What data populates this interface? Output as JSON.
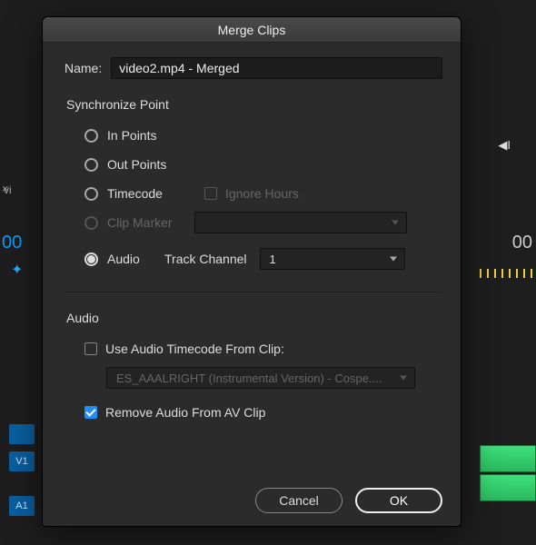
{
  "dialog": {
    "title": "Merge Clips",
    "name_label": "Name:",
    "name_value": "video2.mp4 - Merged",
    "sync": {
      "section_label": "Synchronize Point",
      "options": {
        "in_points": "In Points",
        "out_points": "Out Points",
        "timecode": "Timecode",
        "clip_marker": "Clip Marker",
        "audio": "Audio"
      },
      "selected": "audio",
      "ignore_hours_label": "Ignore Hours",
      "track_channel_label": "Track Channel",
      "track_channel_value": "1"
    },
    "audio": {
      "section_label": "Audio",
      "use_timecode_label": "Use Audio Timecode From Clip:",
      "clip_select_value": "ES_AAALRIGHT (Instrumental Version) - Cospe....",
      "remove_av_label": "Remove Audio From AV Clip",
      "remove_av_checked": true
    },
    "buttons": {
      "cancel": "Cancel",
      "ok": "OK"
    }
  },
  "bg": {
    "left_num": "00",
    "right_num": "00",
    "tab_text": "vi",
    "v1": "V1",
    "a1": "A1"
  }
}
